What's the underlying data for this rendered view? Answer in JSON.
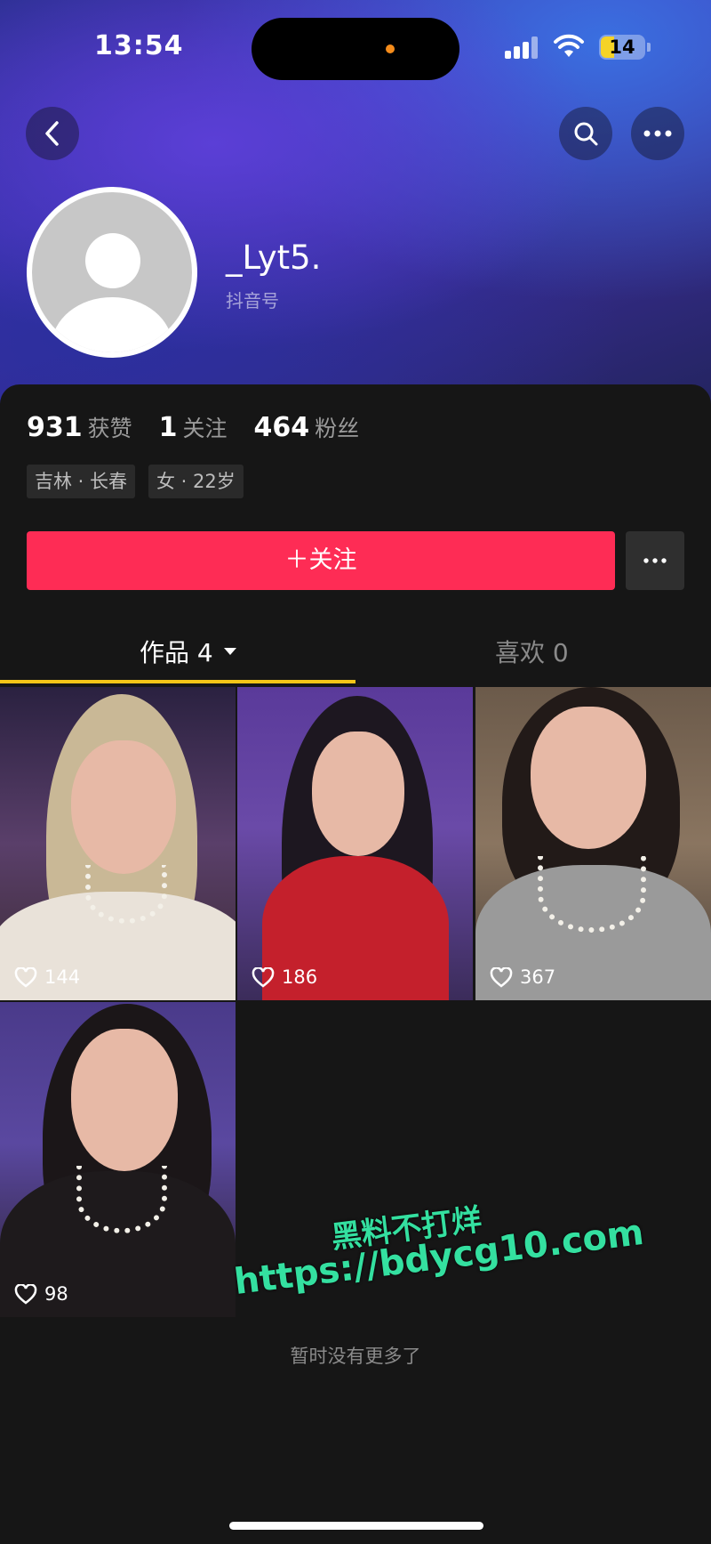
{
  "status_bar": {
    "time": "13:54",
    "battery": "14"
  },
  "profile": {
    "username": "_Lyt5.",
    "douyin_id_label": "抖音号 ",
    "stats": [
      {
        "value": "931",
        "label": "获赞"
      },
      {
        "value": "1",
        "label": "关注"
      },
      {
        "value": "464",
        "label": "粉丝"
      }
    ],
    "tags": [
      "吉林 · 长春",
      "女 · 22岁"
    ]
  },
  "actions": {
    "follow_label": "＋关注"
  },
  "tabs": [
    {
      "label": "作品 4",
      "active": true
    },
    {
      "label": "喜欢 0",
      "active": false
    }
  ],
  "videos": [
    {
      "likes": "144"
    },
    {
      "likes": "186"
    },
    {
      "likes": "367"
    },
    {
      "likes": "98"
    }
  ],
  "footer": {
    "no_more": "暂时没有更多了"
  },
  "watermark": {
    "line1": "黑料不打烊",
    "line2": "https://bdycg10.com"
  },
  "colors": {
    "accent": "#fe2c55",
    "tab_indicator": "#f5c518",
    "watermark": "#34e0a0"
  },
  "icons": [
    "back-icon",
    "search-icon",
    "more-icon",
    "heart-icon",
    "caret-down-icon"
  ]
}
